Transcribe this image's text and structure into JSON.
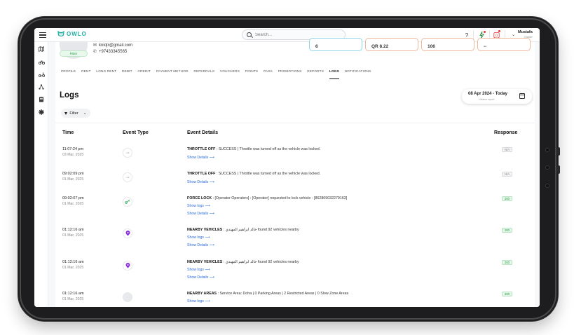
{
  "app": {
    "logo_text": "OWLO",
    "brand_color": "#1ab0a2"
  },
  "header": {
    "search_placeholder": "Search...",
    "help_glyph": "?",
    "user_name": "Mustafa",
    "user_role": "Owner"
  },
  "sidebar": {
    "icons": [
      "map-icon",
      "bike-icon",
      "scooter-icon",
      "network-icon",
      "reports-icon",
      "settings-icon"
    ]
  },
  "profile": {
    "badge": "Rider",
    "email": "kniqtr@gmail.com",
    "phone": "+97433345565",
    "stats": [
      "6",
      "QR 8.22",
      "106",
      "--"
    ]
  },
  "tabs": [
    "PROFILE",
    "RENT",
    "LONG RENT",
    "DEBIT",
    "CREDIT",
    "PAYMENT METHOD",
    "REFERRALS",
    "VOUCHERS",
    "POINTS",
    "PASS",
    "PROMOTIONS",
    "REPORTS",
    "LOGS",
    "NOTIFICATIONS"
  ],
  "active_tab": "LOGS",
  "page": {
    "title": "Logs",
    "date_range": "08 Apr 2024 - Today",
    "date_sub": "Lifetime report",
    "filter_label": "Filter"
  },
  "table": {
    "headers": {
      "time": "Time",
      "event_type": "Event Type",
      "details": "Event Details",
      "response": "Response"
    },
    "rows": [
      {
        "time": "11:07:24 pm",
        "date": "03 Mar, 2025",
        "icon": "throttle-icon",
        "title": "THROTTLE OFF",
        "text": " : SUCCESS | Throttle was turned off as the vehicle was locked.",
        "links": [
          "Show Details ⟶"
        ],
        "response": "N/A"
      },
      {
        "time": "09:02:09 pm",
        "date": "01 Mar, 2025",
        "icon": "throttle-icon",
        "title": "THROTTLE OFF",
        "text": " : SUCCESS | Throttle was turned off as the vehicle was locked.",
        "links": [
          "Show Details ⟶"
        ],
        "response": "N/A"
      },
      {
        "time": "09:02:07 pm",
        "date": "01 Mar, 2025",
        "icon": "force-lock-icon",
        "title": "FORCE LOCK",
        "text": " : [Operator Operators] : [Operator] requested to lock vehicle - [862869032279163]",
        "links": [
          "Show logs ⟶",
          "Show Details ⟶"
        ],
        "response": "200"
      },
      {
        "time": "01:12:16 am",
        "date": "01 Mar, 2025",
        "icon": "location-pin-icon",
        "title": "NEARBY VEHICLES",
        "text": " : خالد ابراهيم المهندي found 92 vehicles nearby",
        "links": [
          "Show logs ⟶",
          "Show Details ⟶"
        ],
        "response": "200"
      },
      {
        "time": "01:12:16 am",
        "date": "01 Mar, 2025",
        "icon": "location-pin-icon",
        "title": "NEARBY VEHICLES",
        "text": " : خالد ابراهيم المهندي found 92 vehicles nearby",
        "links": [
          "Show logs ⟶",
          "Show Details ⟶"
        ],
        "response": "200"
      },
      {
        "time": "01:12:16 am",
        "date": "01 Mar, 2025",
        "icon": "blank-icon",
        "title": "NEARBY AREAS",
        "text": " : Service Area: Doha | 0 Parking Areas | 2 Restricted Areas | 0 Slow Zone Areas",
        "links": [
          "Show logs ⟶"
        ],
        "response": "200"
      }
    ]
  }
}
